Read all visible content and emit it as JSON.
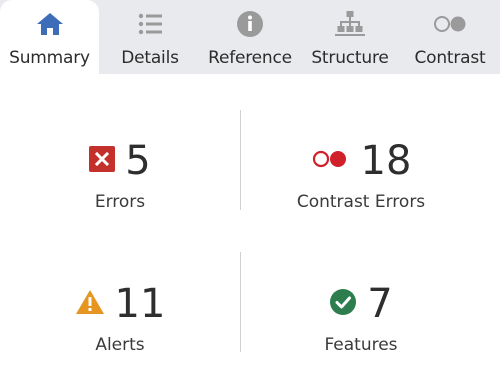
{
  "tabs": [
    {
      "label": "Summary",
      "icon": "home-icon",
      "active": true
    },
    {
      "label": "Details",
      "icon": "list-icon",
      "active": false
    },
    {
      "label": "Reference",
      "icon": "info-icon",
      "active": false
    },
    {
      "label": "Structure",
      "icon": "hierarchy-icon",
      "active": false
    },
    {
      "label": "Contrast",
      "icon": "contrast-icon",
      "active": false
    }
  ],
  "summary": {
    "errors": {
      "value": "5",
      "label": "Errors",
      "icon": "error-x-icon",
      "color": "#c4302b"
    },
    "contrast_errors": {
      "value": "18",
      "label": "Contrast Errors",
      "icon": "contrast-error-icon",
      "color": "#d0202a"
    },
    "alerts": {
      "value": "11",
      "label": "Alerts",
      "icon": "alert-triangle-icon",
      "color": "#e69521"
    },
    "features": {
      "value": "7",
      "label": "Features",
      "icon": "feature-check-icon",
      "color": "#2e7d4f"
    }
  },
  "colors": {
    "tab_bar_bg": "#e8eaed",
    "active_icon": "#3d6db8",
    "inactive_icon": "#9a9a9a"
  }
}
